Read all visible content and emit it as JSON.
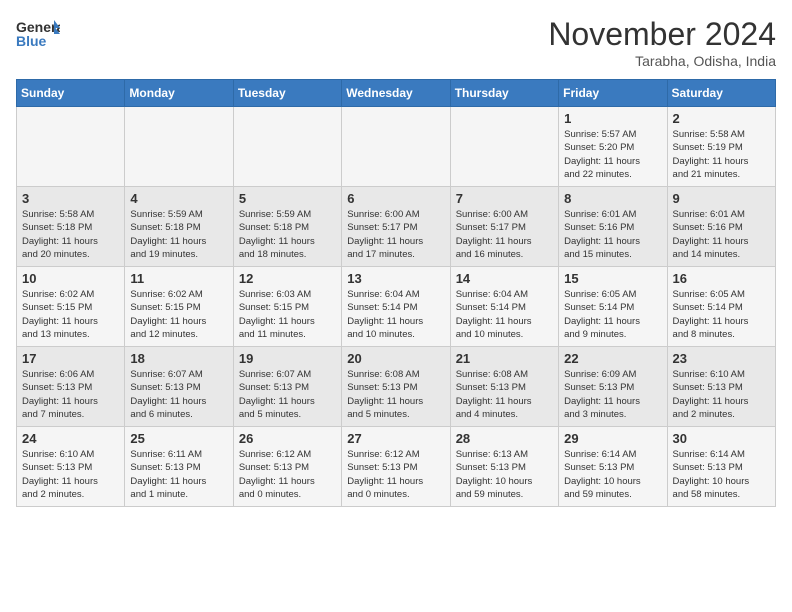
{
  "header": {
    "logo_text_general": "General",
    "logo_text_blue": "Blue",
    "month": "November 2024",
    "location": "Tarabha, Odisha, India"
  },
  "weekdays": [
    "Sunday",
    "Monday",
    "Tuesday",
    "Wednesday",
    "Thursday",
    "Friday",
    "Saturday"
  ],
  "weeks": [
    [
      {
        "day": "",
        "info": ""
      },
      {
        "day": "",
        "info": ""
      },
      {
        "day": "",
        "info": ""
      },
      {
        "day": "",
        "info": ""
      },
      {
        "day": "",
        "info": ""
      },
      {
        "day": "1",
        "info": "Sunrise: 5:57 AM\nSunset: 5:20 PM\nDaylight: 11 hours\nand 22 minutes."
      },
      {
        "day": "2",
        "info": "Sunrise: 5:58 AM\nSunset: 5:19 PM\nDaylight: 11 hours\nand 21 minutes."
      }
    ],
    [
      {
        "day": "3",
        "info": "Sunrise: 5:58 AM\nSunset: 5:18 PM\nDaylight: 11 hours\nand 20 minutes."
      },
      {
        "day": "4",
        "info": "Sunrise: 5:59 AM\nSunset: 5:18 PM\nDaylight: 11 hours\nand 19 minutes."
      },
      {
        "day": "5",
        "info": "Sunrise: 5:59 AM\nSunset: 5:18 PM\nDaylight: 11 hours\nand 18 minutes."
      },
      {
        "day": "6",
        "info": "Sunrise: 6:00 AM\nSunset: 5:17 PM\nDaylight: 11 hours\nand 17 minutes."
      },
      {
        "day": "7",
        "info": "Sunrise: 6:00 AM\nSunset: 5:17 PM\nDaylight: 11 hours\nand 16 minutes."
      },
      {
        "day": "8",
        "info": "Sunrise: 6:01 AM\nSunset: 5:16 PM\nDaylight: 11 hours\nand 15 minutes."
      },
      {
        "day": "9",
        "info": "Sunrise: 6:01 AM\nSunset: 5:16 PM\nDaylight: 11 hours\nand 14 minutes."
      }
    ],
    [
      {
        "day": "10",
        "info": "Sunrise: 6:02 AM\nSunset: 5:15 PM\nDaylight: 11 hours\nand 13 minutes."
      },
      {
        "day": "11",
        "info": "Sunrise: 6:02 AM\nSunset: 5:15 PM\nDaylight: 11 hours\nand 12 minutes."
      },
      {
        "day": "12",
        "info": "Sunrise: 6:03 AM\nSunset: 5:15 PM\nDaylight: 11 hours\nand 11 minutes."
      },
      {
        "day": "13",
        "info": "Sunrise: 6:04 AM\nSunset: 5:14 PM\nDaylight: 11 hours\nand 10 minutes."
      },
      {
        "day": "14",
        "info": "Sunrise: 6:04 AM\nSunset: 5:14 PM\nDaylight: 11 hours\nand 10 minutes."
      },
      {
        "day": "15",
        "info": "Sunrise: 6:05 AM\nSunset: 5:14 PM\nDaylight: 11 hours\nand 9 minutes."
      },
      {
        "day": "16",
        "info": "Sunrise: 6:05 AM\nSunset: 5:14 PM\nDaylight: 11 hours\nand 8 minutes."
      }
    ],
    [
      {
        "day": "17",
        "info": "Sunrise: 6:06 AM\nSunset: 5:13 PM\nDaylight: 11 hours\nand 7 minutes."
      },
      {
        "day": "18",
        "info": "Sunrise: 6:07 AM\nSunset: 5:13 PM\nDaylight: 11 hours\nand 6 minutes."
      },
      {
        "day": "19",
        "info": "Sunrise: 6:07 AM\nSunset: 5:13 PM\nDaylight: 11 hours\nand 5 minutes."
      },
      {
        "day": "20",
        "info": "Sunrise: 6:08 AM\nSunset: 5:13 PM\nDaylight: 11 hours\nand 5 minutes."
      },
      {
        "day": "21",
        "info": "Sunrise: 6:08 AM\nSunset: 5:13 PM\nDaylight: 11 hours\nand 4 minutes."
      },
      {
        "day": "22",
        "info": "Sunrise: 6:09 AM\nSunset: 5:13 PM\nDaylight: 11 hours\nand 3 minutes."
      },
      {
        "day": "23",
        "info": "Sunrise: 6:10 AM\nSunset: 5:13 PM\nDaylight: 11 hours\nand 2 minutes."
      }
    ],
    [
      {
        "day": "24",
        "info": "Sunrise: 6:10 AM\nSunset: 5:13 PM\nDaylight: 11 hours\nand 2 minutes."
      },
      {
        "day": "25",
        "info": "Sunrise: 6:11 AM\nSunset: 5:13 PM\nDaylight: 11 hours\nand 1 minute."
      },
      {
        "day": "26",
        "info": "Sunrise: 6:12 AM\nSunset: 5:13 PM\nDaylight: 11 hours\nand 0 minutes."
      },
      {
        "day": "27",
        "info": "Sunrise: 6:12 AM\nSunset: 5:13 PM\nDaylight: 11 hours\nand 0 minutes."
      },
      {
        "day": "28",
        "info": "Sunrise: 6:13 AM\nSunset: 5:13 PM\nDaylight: 10 hours\nand 59 minutes."
      },
      {
        "day": "29",
        "info": "Sunrise: 6:14 AM\nSunset: 5:13 PM\nDaylight: 10 hours\nand 59 minutes."
      },
      {
        "day": "30",
        "info": "Sunrise: 6:14 AM\nSunset: 5:13 PM\nDaylight: 10 hours\nand 58 minutes."
      }
    ]
  ]
}
